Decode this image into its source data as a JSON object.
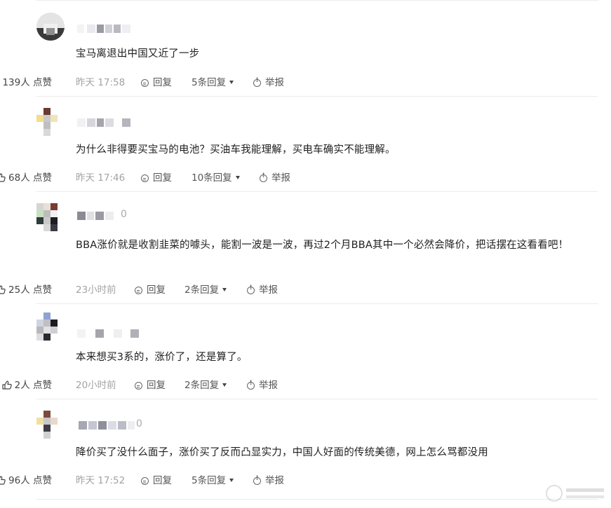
{
  "comments": [
    {
      "name_tail": "",
      "text": "宝马离退出中国又近了一步",
      "time": "昨天 17:58",
      "reply_label": "回复",
      "replies": "5条回复",
      "report_label": "举报",
      "likes": "139人 点赞"
    },
    {
      "name_tail": "",
      "text": "为什么非得要买宝马的电池？买油车我能理解，买电车确实不能理解。",
      "time": "昨天 17:46",
      "reply_label": "回复",
      "replies": "10条回复",
      "report_label": "举报",
      "likes": "68人 点赞"
    },
    {
      "name_tail": "0",
      "text": "BBA涨价就是收割韭菜的噱头，能割一波是一波，再过2个月BBA其中一个必然会降价，把话摆在这看看吧！",
      "time": "23小时前",
      "reply_label": "回复",
      "replies": "2条回复",
      "report_label": "举报",
      "likes": "25人 点赞"
    },
    {
      "name_tail": "",
      "text": "本来想买3系的，涨价了，还是算了。",
      "time": "20小时前",
      "reply_label": "回复",
      "replies": "2条回复",
      "report_label": "举报",
      "likes": "2人 点赞"
    },
    {
      "name_tail": "0",
      "text": "降价买了没什么面子，涨价买了反而凸显实力，中国人好面的传统美德，网上怎么骂都没用",
      "time": "昨天 17:52",
      "reply_label": "回复",
      "replies": "5条回复",
      "report_label": "举报",
      "likes": "96人 点赞"
    }
  ],
  "icons": {
    "reply": "reply-bubble-icon",
    "report": "report-alert-icon",
    "like": "thumbs-up-icon",
    "expand": "caret-down-icon"
  },
  "colors": {
    "text": "#1f1f1f",
    "meta": "#a3a3a3",
    "divider": "#ebebeb"
  }
}
